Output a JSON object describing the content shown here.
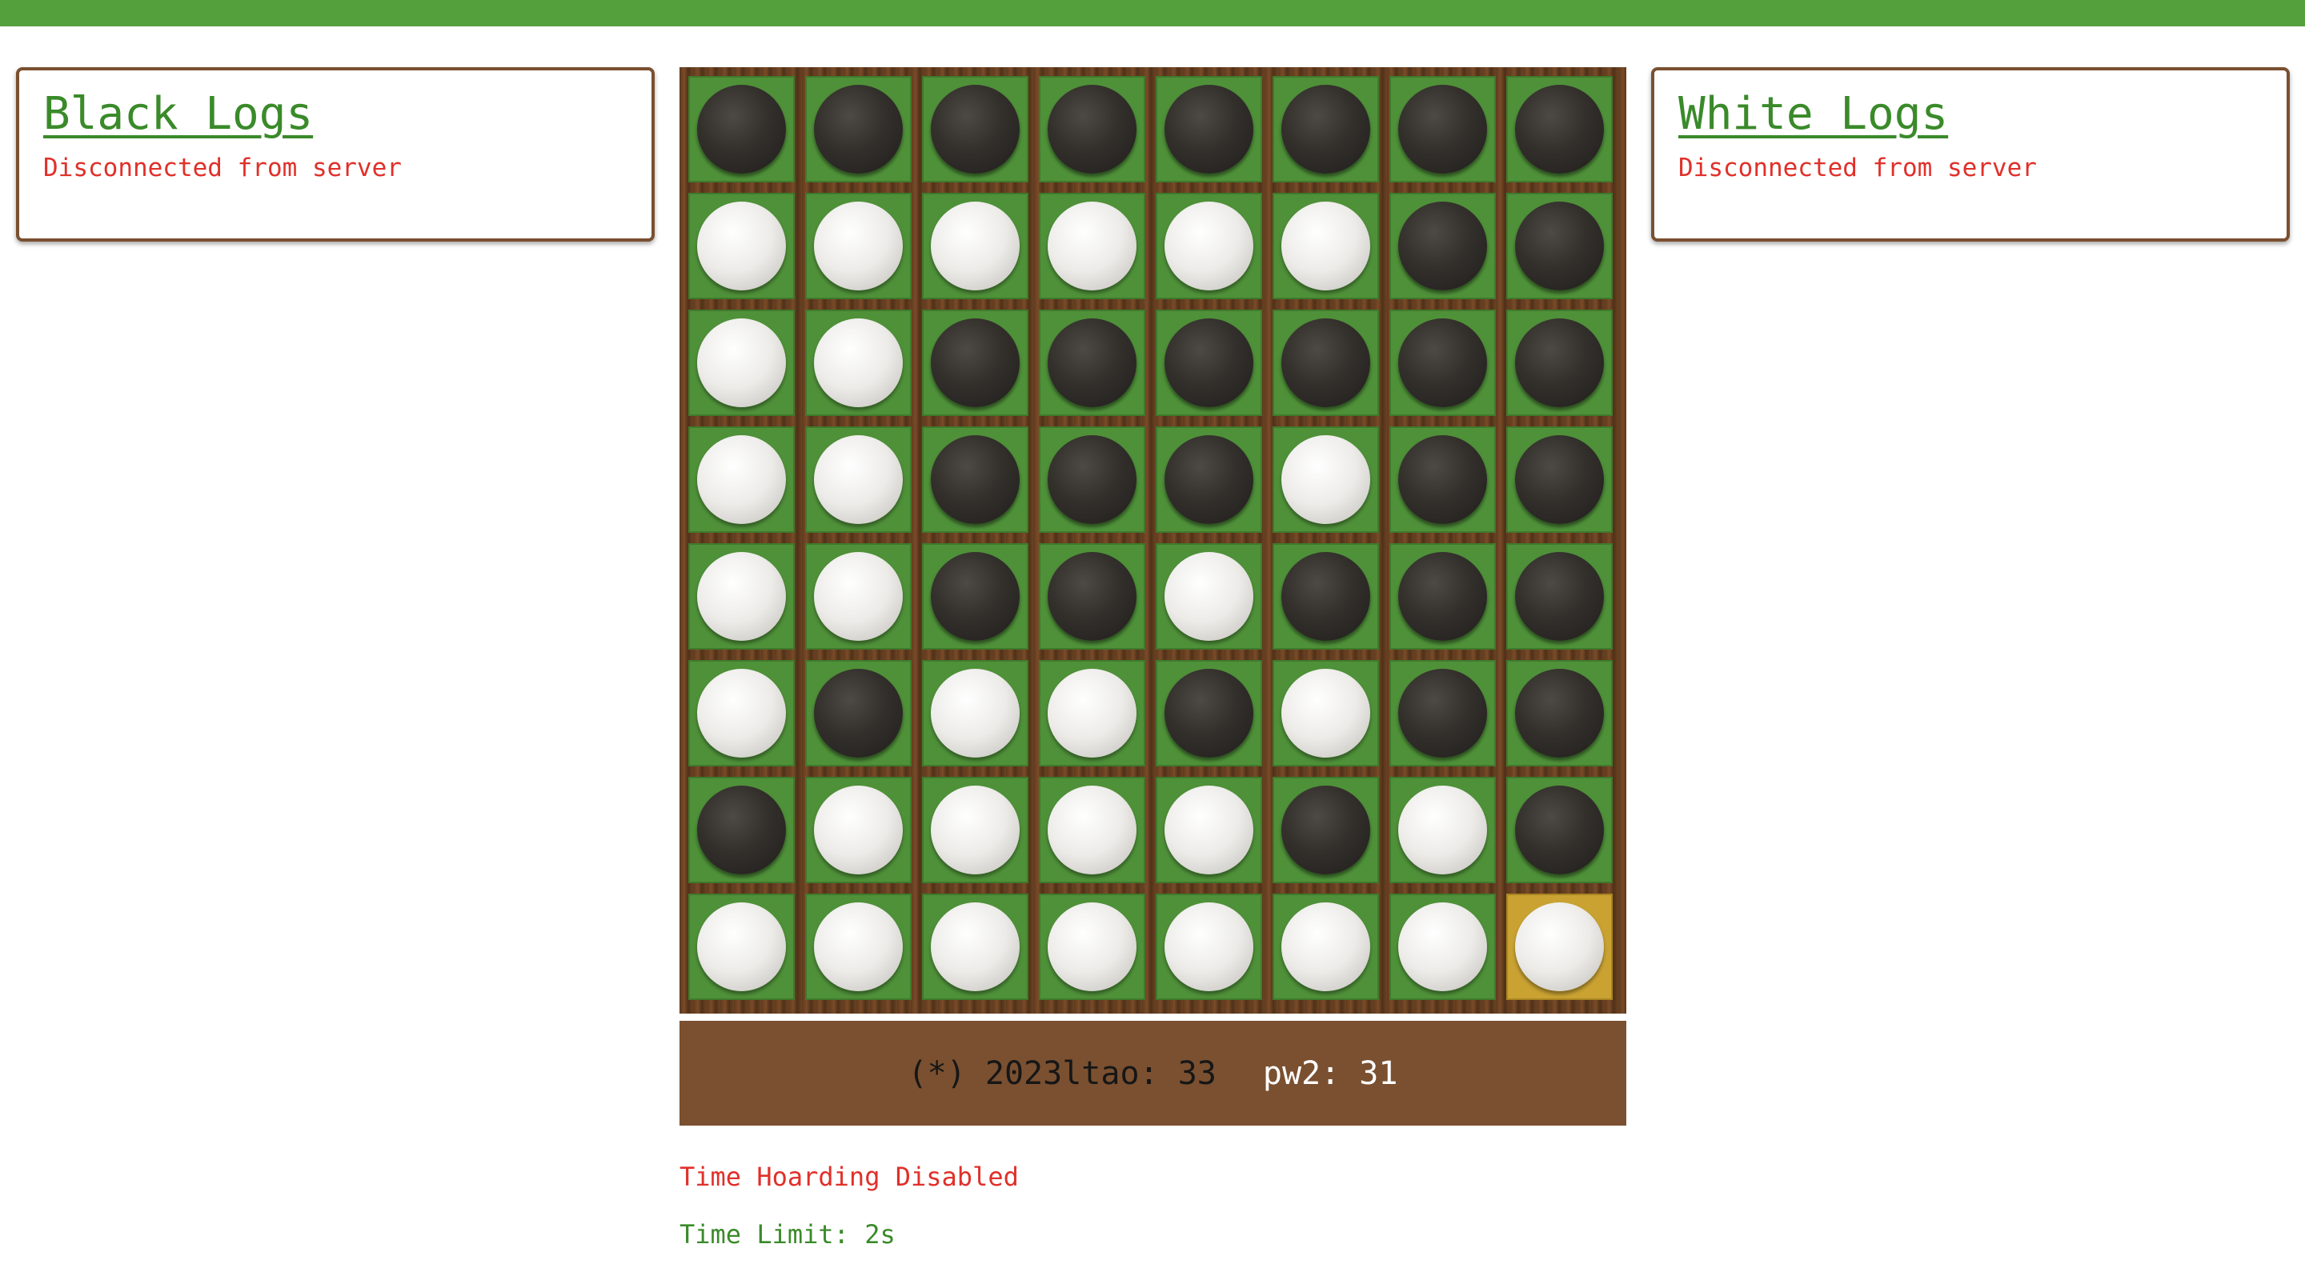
{
  "colors": {
    "accent_green": "#54a03c",
    "board_green": "#4f9139",
    "board_wood": "#7a5030",
    "last_move_highlight": "#c9a232",
    "error_red": "#e0302a"
  },
  "black_logs": {
    "title": "Black Logs",
    "status": "Disconnected from server"
  },
  "white_logs": {
    "title": "White Logs",
    "status": "Disconnected from server"
  },
  "board": {
    "rows": [
      "BBBBBBBB",
      "WWWWWWBB",
      "WWBBBBBB",
      "WWBBBWBB",
      "WWBBWBBB",
      "WBWWBWBB",
      "BWWWWBWB",
      "WWWWWWWW"
    ],
    "last_move": [
      7,
      7
    ]
  },
  "score": {
    "black": "(*) 2023ltao: 33",
    "white": "pw2: 31"
  },
  "info": {
    "time_hoarding": "Time Hoarding Disabled",
    "time_limit": "Time Limit: 2s"
  }
}
